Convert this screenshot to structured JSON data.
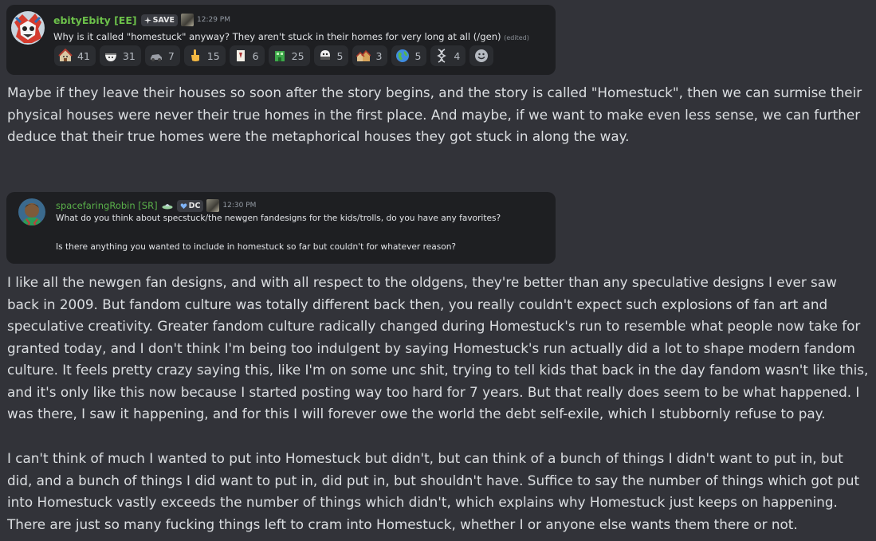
{
  "message1": {
    "username": "ebityEbity [EE]",
    "tag_label": "SAVE",
    "tag_icon": "sparkle-icon",
    "timestamp": "12:29 PM",
    "text": "Why is it called \"homestuck\" anyway? They aren't stuck in their homes for very long at all (/gen)",
    "edited": "(edited)",
    "reactions": [
      {
        "emoji": "house-with-face",
        "count": "41"
      },
      {
        "emoji": "bowl-with-face",
        "count": "31"
      },
      {
        "emoji": "grey-car",
        "count": "7"
      },
      {
        "emoji": "pointing-hand",
        "count": "15"
      },
      {
        "emoji": "white-card",
        "count": "6"
      },
      {
        "emoji": "green-building",
        "count": "25"
      },
      {
        "emoji": "ghost-face",
        "count": "5"
      },
      {
        "emoji": "houses",
        "count": "3"
      },
      {
        "emoji": "globe",
        "count": "5"
      },
      {
        "emoji": "dna-strand",
        "count": "4"
      }
    ],
    "add_reaction_icon": "add-reaction-icon"
  },
  "reply1": "Maybe if they leave their houses so soon after the story begins, and the story is called \"Homestuck\", then we can surmise their physical houses were never their true homes in the first place. And maybe, if we want to make even less sense, we can further deduce that their true homes were the metaphorical houses they got stuck in along the way.",
  "message2": {
    "username": "spacefaringRobin [SR]",
    "ufo_icon": "ufo-icon",
    "tag_label": "DC",
    "tag_icon": "heart-shield-icon",
    "timestamp": "12:30 PM",
    "line1": "What do you think about specstuck/the newgen fandesigns for the kids/trolls, do you have any favorites?",
    "line2": "Is there anything you wanted to include in homestuck so far but couldn't for whatever reason?"
  },
  "reply2": "I like all the newgen fan designs, and with all respect to the oldgens, they're better than any speculative designs I ever saw back in 2009. But fandom culture was totally different back then, you really couldn't expect such explosions of fan art and speculative creativity. Greater fandom culture radically changed during Homestuck's run to resemble what people now take for granted today, and I don't think I'm being too indulgent by saying Homestuck's run actually did a lot to shape modern fandom culture. It feels pretty crazy saying this, like I'm on some unc shit, trying to tell kids that back in the day fandom wasn't like this, and it's only like this now because I started posting way too hard for 7 years. But that really does seem to be what happened. I was there, I saw it happening, and for this I will forever owe the world the debt self-exile, which I stubbornly refuse to pay.",
  "reply3": "I can't think of much I wanted to put into Homestuck but didn't, but can think of a bunch of things I didn't want to put in, but did, and a bunch of things I did want to put in, did put in, but shouldn't have. Suffice to say the number of things which got put into Homestuck vastly exceeds the number of things which didn't, which explains why Homestuck just keeps on happening. There are just so many fucking things left to cram into Homestuck, whether I or anyone else wants them there or not."
}
